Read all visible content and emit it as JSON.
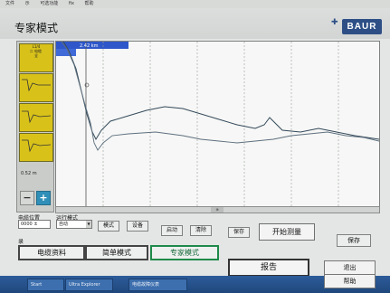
{
  "menu": [
    "文件",
    "示",
    "可选功能",
    "fix",
    "帮助"
  ],
  "app_title": "专家模式",
  "logo_text": "BAUR",
  "sidebar": {
    "thumb_labels": [
      "L1/4\n二 电缆 \n全",
      "",
      "",
      "",
      ""
    ],
    "range_readout": "0.52 m",
    "zoom_out_label": "−",
    "zoom_in_label": "+"
  },
  "plot": {
    "header_text": "2.42 km",
    "scroll_label": "⊕"
  },
  "controls": {
    "cable_label": "电缆位置",
    "cable_value": "0000 ±",
    "mode_label": "运行模式",
    "mode_value": "自动",
    "mode_btn": "模式",
    "settings_btn": "设备",
    "start_stop_btn": "启动",
    "clear_btn": "清除",
    "save_btn": "保存",
    "start_measure": "开始测量",
    "save_right": "保存",
    "row2_label": "录"
  },
  "tabs": {
    "cable_data": "电缆资料",
    "simple_mode": "简单模式",
    "expert_mode": "专家模式",
    "report": "报告"
  },
  "side": {
    "exit": "退出",
    "help": "帮助"
  },
  "taskbar": {
    "items": [
      "Start",
      "Ultra Explorer",
      "电缆故障仪表"
    ],
    "time": ""
  },
  "colors": {
    "accent": "#1f8a4a",
    "logo": "#2e4f86",
    "thumb": "#d8c21a"
  }
}
